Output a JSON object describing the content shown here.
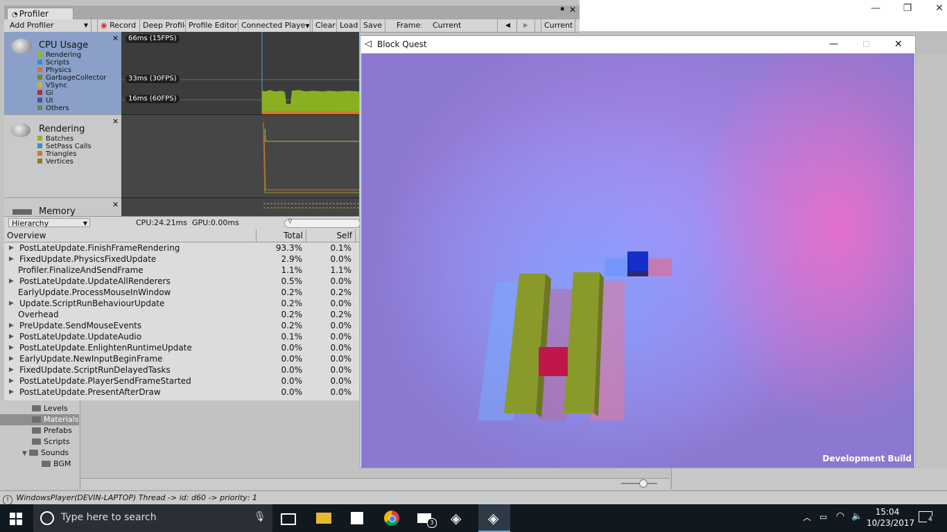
{
  "editor": {
    "status_text": "WindowsPlayer(DEVIN-LAPTOP)    Thread -> id: d60 -> priority: 1",
    "folders": [
      {
        "label": "Levels",
        "selected": false
      },
      {
        "label": "Materials",
        "selected": true
      },
      {
        "label": "Prefabs",
        "selected": false
      },
      {
        "label": "Scripts",
        "selected": false
      },
      {
        "label": "Sounds",
        "selected": false
      },
      {
        "label": "BGM",
        "selected": false
      }
    ]
  },
  "profiler": {
    "tab_label": "Profiler",
    "toolbar": {
      "add_profiler": "Add Profiler",
      "record": "Record",
      "deep_profile": "Deep Profile",
      "profile_editor": "Profile Editor",
      "connected_player": "Connected Playe",
      "clear": "Clear",
      "load": "Load",
      "save": "Save",
      "frame_label": "Frame:",
      "frame_value": "Current",
      "current_button": "Current"
    },
    "modules": {
      "cpu": {
        "title": "CPU Usage",
        "legend": [
          {
            "label": "Rendering",
            "color": "#8cb82a"
          },
          {
            "label": "Scripts",
            "color": "#3a8fc4"
          },
          {
            "label": "Physics",
            "color": "#d8742a"
          },
          {
            "label": "GarbageCollector",
            "color": "#6f8a2a"
          },
          {
            "label": "VSync",
            "color": "#c8b43a"
          },
          {
            "label": "Gi",
            "color": "#a8322a"
          },
          {
            "label": "UI",
            "color": "#5a4a9a"
          },
          {
            "label": "Others",
            "color": "#6a8a4a"
          }
        ]
      },
      "rendering": {
        "title": "Rendering",
        "legend": [
          {
            "label": "Batches",
            "color": "#8cb82a"
          },
          {
            "label": "SetPass Calls",
            "color": "#3a8fc4"
          },
          {
            "label": "Triangles",
            "color": "#d8742a"
          },
          {
            "label": "Vertices",
            "color": "#8a7a2a"
          }
        ]
      },
      "memory": {
        "title": "Memory"
      }
    },
    "graph_labels": [
      "66ms (15FPS)",
      "33ms (30FPS)",
      "16ms (60FPS)"
    ],
    "lower": {
      "view_mode": "Hierarchy",
      "cpu_time": "CPU:24.21ms",
      "gpu_time": "GPU:0.00ms"
    },
    "table": {
      "headers": {
        "overview": "Overview",
        "total": "Total",
        "self": "Self"
      },
      "rows": [
        {
          "name": "PostLateUpdate.FinishFrameRendering",
          "total": "93.3%",
          "self": "0.1%",
          "expandable": true
        },
        {
          "name": "FixedUpdate.PhysicsFixedUpdate",
          "total": "2.9%",
          "self": "0.0%",
          "expandable": true
        },
        {
          "name": "Profiler.FinalizeAndSendFrame",
          "total": "1.1%",
          "self": "1.1%",
          "expandable": false
        },
        {
          "name": "PostLateUpdate.UpdateAllRenderers",
          "total": "0.5%",
          "self": "0.0%",
          "expandable": true
        },
        {
          "name": "EarlyUpdate.ProcessMouseInWindow",
          "total": "0.2%",
          "self": "0.2%",
          "expandable": false
        },
        {
          "name": "Update.ScriptRunBehaviourUpdate",
          "total": "0.2%",
          "self": "0.0%",
          "expandable": true
        },
        {
          "name": "Overhead",
          "total": "0.2%",
          "self": "0.2%",
          "expandable": false
        },
        {
          "name": "PreUpdate.SendMouseEvents",
          "total": "0.2%",
          "self": "0.0%",
          "expandable": true
        },
        {
          "name": "PostLateUpdate.UpdateAudio",
          "total": "0.1%",
          "self": "0.0%",
          "expandable": true
        },
        {
          "name": "PostLateUpdate.EnlightenRuntimeUpdate",
          "total": "0.0%",
          "self": "0.0%",
          "expandable": true
        },
        {
          "name": "EarlyUpdate.NewInputBeginFrame",
          "total": "0.0%",
          "self": "0.0%",
          "expandable": true
        },
        {
          "name": "FixedUpdate.ScriptRunDelayedTasks",
          "total": "0.0%",
          "self": "0.0%",
          "expandable": true
        },
        {
          "name": "PostLateUpdate.PlayerSendFrameStarted",
          "total": "0.0%",
          "self": "0.0%",
          "expandable": true
        },
        {
          "name": "PostLateUpdate.PresentAfterDraw",
          "total": "0.0%",
          "self": "0.0%",
          "expandable": true
        }
      ]
    }
  },
  "game_window": {
    "title": "Block Quest",
    "watermark": "Development Build"
  },
  "taskbar": {
    "search_placeholder": "Type here to search",
    "time": "15:04",
    "date": "10/23/2017",
    "notification_count": "4",
    "mail_badge": "3"
  }
}
